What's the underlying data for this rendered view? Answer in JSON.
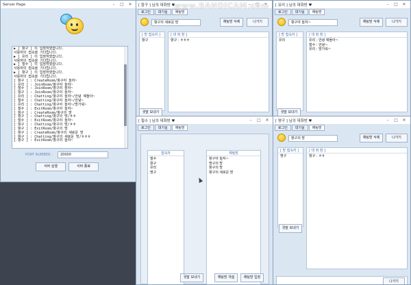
{
  "watermark": "www.BANDICAM.com",
  "server": {
    "title": "Server Page",
    "log": [
      "▶ [ 항구 ] 이 입장하였습니다.",
      "사용자의 접속을 기다립니다.",
      "▶ [ 유리 ] 이 입장하였습니다.",
      "사용자의 접속을 기다립니다.",
      "▶ [ 철수 ] 이 입장하였습니다.",
      "사용자의 접속을 기다립니다.",
      "▶ [ 항구 ] 이 입장하였습니다.",
      "사용자의 접속을 기다립니다.",
      "[ 항구 ] : CreateRoom/항구야 놀자~",
      "[ 유리 ] : JoinRoom/항구야 놀자~",
      "[ 철수 ] : JoinRoom/항구야 놀자~",
      "[ 항구 ] : JoinRoom/항구야 놀자~",
      "[ 유리 ] : Chatting/항구야 놀자~/안녕 얘들아~",
      "[ 철수 ] : Chatting/항구야 놀자~/안녕~",
      "[ 유리 ] : Chatting/항구야 놀자~/방가워~",
      "[ 철수 ] : ExitRoom/항구야 놀자~",
      "[ 항구 ] : CreateRoom/항구의 방",
      "[ 항구 ] : Chatting/항구의 방/ㅎㅎ",
      "[ 철수 ] : ExitRoom/항구야 놀자~",
      "[ 항구 ] : Chatting/항구의 방/ㅎㅎ",
      "[ 항구 ] : ExitRoom/항구의 방",
      "[ 항구 ] : CreateRoom/항구의 새로운 방",
      "[ 항구 ] : Chatting/항구의 새로운 방/ㅎㅎㅎ",
      "[ 항구 ] : ExitRoom/항구야 놀자~"
    ],
    "port_label": "PORT NUMBER :",
    "port_value": "20000",
    "start_btn": "서버 실행",
    "stop_btn": "서버 종료"
  },
  "chat1": {
    "title": "[ 항구 ] 님의 대화방 ♥",
    "tabs": [
      "로그인",
      "대기실",
      "채팅방"
    ],
    "room_name": "항구의 새로운 방",
    "delete_btn": "채팅방 삭제",
    "exit_btn": "나가기",
    "users_header": "[ 방 접속자 ]",
    "chat_header": "[ 대 화 창 ]",
    "users": [
      "항구"
    ],
    "messages": [
      "항구 : ㅎㅎㅎ"
    ],
    "whisper_btn": "귓말 보내기"
  },
  "chat2": {
    "title": "[ 유리 ] 님의 대화방 ♥",
    "tabs": [
      "로그인",
      "대기실",
      "채팅방"
    ],
    "room_name": "항구야 놀자~",
    "delete_btn": "채팅방 삭제",
    "exit_btn": "나가기",
    "users_header": "[ 방 접속자 ]",
    "chat_header": "[ 대 화 창 ]",
    "users": [
      "유리"
    ],
    "messages": [
      "유리 : 안녕 얘들아~",
      "철수 : 안녕~",
      "유리 : 방가워~"
    ],
    "whisper_btn": "귓말 보내기"
  },
  "waiting": {
    "title": "[ 철수 ] 님의 대화방 ♥",
    "tabs": [
      "로그인",
      "대기실",
      "채팅방"
    ],
    "users_header": "접속자",
    "rooms_header": "채팅방",
    "users": [
      "철수",
      "항구",
      "유리",
      "명구"
    ],
    "rooms": [
      "항구야 놀자~",
      "명구의 방",
      "항구의 방",
      "항구의 새로운 방"
    ],
    "whisper_btn": "귓말 보내기",
    "create_btn": "채팅방 개설",
    "enter_btn": "채팅방 입장"
  },
  "chat3": {
    "title": "[ 명구 ] 님의 대화방 ♥",
    "tabs": [
      "로그인",
      "대기실",
      "채팅방"
    ],
    "room_name": "항구의 방",
    "delete_btn": "채팅방 삭제",
    "exit_btn": "나가기",
    "users_header": "[ 방 접속자 ]",
    "chat_header": "[ 대 화 창 ]",
    "users": [
      "명구"
    ],
    "messages": [
      "항구 : ㅎㅎ"
    ],
    "whisper_btn": "귓말 보내기",
    "bottom_btn": "나가기"
  }
}
